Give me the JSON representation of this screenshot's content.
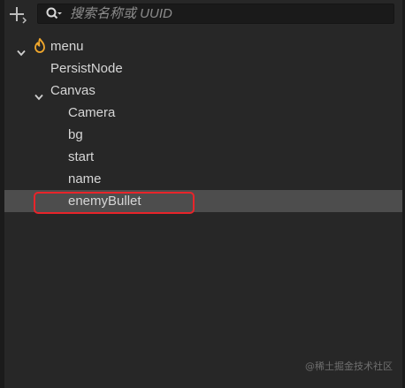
{
  "search": {
    "placeholder": "搜索名称或 UUID",
    "value": ""
  },
  "tree": {
    "items": [
      {
        "label": "menu",
        "depth": 0,
        "expanded": true,
        "icon": "scene-flame-icon"
      },
      {
        "label": "PersistNode",
        "depth": 1
      },
      {
        "label": "Canvas",
        "depth": 1,
        "expanded": true
      },
      {
        "label": "Camera",
        "depth": 2
      },
      {
        "label": "bg",
        "depth": 2
      },
      {
        "label": "start",
        "depth": 2
      },
      {
        "label": "name",
        "depth": 2
      },
      {
        "label": "enemyBullet",
        "depth": 2,
        "selected": true
      }
    ]
  },
  "annotation": {
    "color": "#e8242a"
  },
  "colors": {
    "panel": "#272727",
    "selected_row": "#4d4d4d",
    "text": "#d6d6d6",
    "scene_icon": "#f0a72c"
  },
  "watermark": {
    "text": "@稀土掘金技术社区"
  }
}
